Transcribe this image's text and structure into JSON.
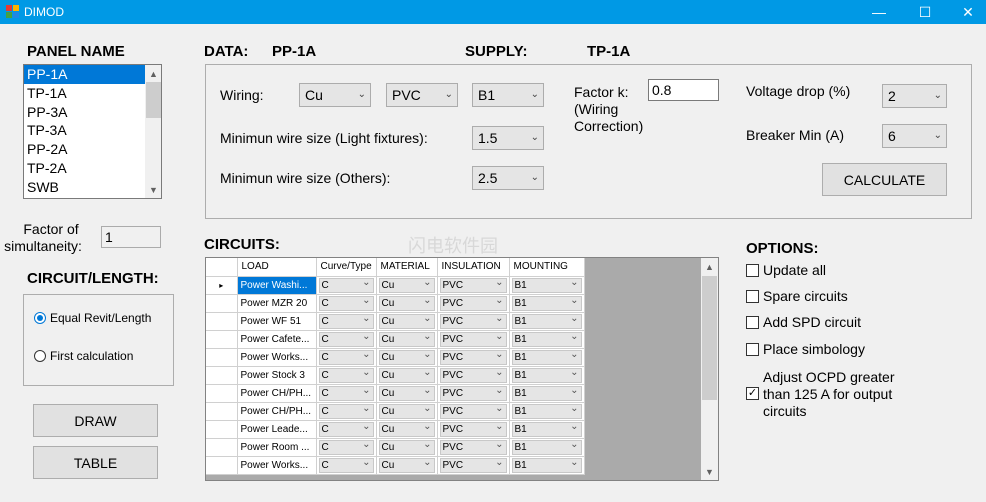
{
  "window": {
    "title": "DIMOD",
    "minimize": "—",
    "maximize": "☐",
    "close": "✕"
  },
  "panel": {
    "heading": "PANEL NAME",
    "items": [
      "PP-1A",
      "TP-1A",
      "PP-3A",
      "TP-3A",
      "PP-2A",
      "TP-2A",
      "SWB"
    ],
    "selected": "PP-1A"
  },
  "factor_simultaneity": {
    "label_line1": "Factor of",
    "label_line2": "simultaneity:",
    "value": "1"
  },
  "circuit_length": {
    "heading": "CIRCUIT/LENGTH:",
    "options": [
      "Equal Revit/Length",
      "First calculation"
    ],
    "selected": "Equal Revit/Length"
  },
  "buttons": {
    "draw": "DRAW",
    "table": "TABLE",
    "calculate": "CALCULATE"
  },
  "data_header": {
    "label": "DATA:",
    "value": "PP-1A",
    "supply_label": "SUPPLY:",
    "supply_value": "TP-1A"
  },
  "wiring": {
    "label": "Wiring:",
    "material": "Cu",
    "insulation": "PVC",
    "mounting": "B1"
  },
  "min_wire_light": {
    "label": "Minimun wire size (Light fixtures):",
    "value": "1.5"
  },
  "min_wire_others": {
    "label": "Minimun wire size (Others):",
    "value": "2.5"
  },
  "factor_k": {
    "label_line1": "Factor k:",
    "label_line2": "(Wiring",
    "label_line3": "Correction)",
    "value": "0.8"
  },
  "voltage_drop": {
    "label": "Voltage drop (%)",
    "value": "2"
  },
  "breaker_min": {
    "label": "Breaker Min (A)",
    "value": "6"
  },
  "circuits": {
    "heading": "CIRCUITS:",
    "columns": [
      "LOAD",
      "Curve/Type",
      "MATERIAL",
      "INSULATION",
      "MOUNTING"
    ],
    "current_row_marker": "▸",
    "rows": [
      {
        "load": "Power Washi...",
        "curve": "C",
        "material": "Cu",
        "insulation": "PVC",
        "mounting": "B1"
      },
      {
        "load": "Power MZR 20",
        "curve": "C",
        "material": "Cu",
        "insulation": "PVC",
        "mounting": "B1"
      },
      {
        "load": "Power WF 51",
        "curve": "C",
        "material": "Cu",
        "insulation": "PVC",
        "mounting": "B1"
      },
      {
        "load": "Power Cafete...",
        "curve": "C",
        "material": "Cu",
        "insulation": "PVC",
        "mounting": "B1"
      },
      {
        "load": "Power Works...",
        "curve": "C",
        "material": "Cu",
        "insulation": "PVC",
        "mounting": "B1"
      },
      {
        "load": "Power Stock 3",
        "curve": "C",
        "material": "Cu",
        "insulation": "PVC",
        "mounting": "B1"
      },
      {
        "load": "Power CH/PH...",
        "curve": "C",
        "material": "Cu",
        "insulation": "PVC",
        "mounting": "B1"
      },
      {
        "load": "Power CH/PH...",
        "curve": "C",
        "material": "Cu",
        "insulation": "PVC",
        "mounting": "B1"
      },
      {
        "load": "Power Leade...",
        "curve": "C",
        "material": "Cu",
        "insulation": "PVC",
        "mounting": "B1"
      },
      {
        "load": "Power Room ...",
        "curve": "C",
        "material": "Cu",
        "insulation": "PVC",
        "mounting": "B1"
      },
      {
        "load": "Power Works...",
        "curve": "C",
        "material": "Cu",
        "insulation": "PVC",
        "mounting": "B1"
      }
    ]
  },
  "options": {
    "heading": "OPTIONS:",
    "items": [
      {
        "label": "Update all",
        "checked": false
      },
      {
        "label": "Spare circuits",
        "checked": false
      },
      {
        "label": "Add SPD circuit",
        "checked": false
      },
      {
        "label": "Place simbology",
        "checked": false
      }
    ],
    "ocpd": {
      "line1": "Adjust  OCPD greater",
      "line2": "than 125 A for output",
      "line3": "circuits",
      "checked": true
    }
  },
  "watermark": "闪电软件园",
  "colors": {
    "titlebar": "#0099e5",
    "selection": "#0078d7",
    "background": "#f0f0f0"
  }
}
